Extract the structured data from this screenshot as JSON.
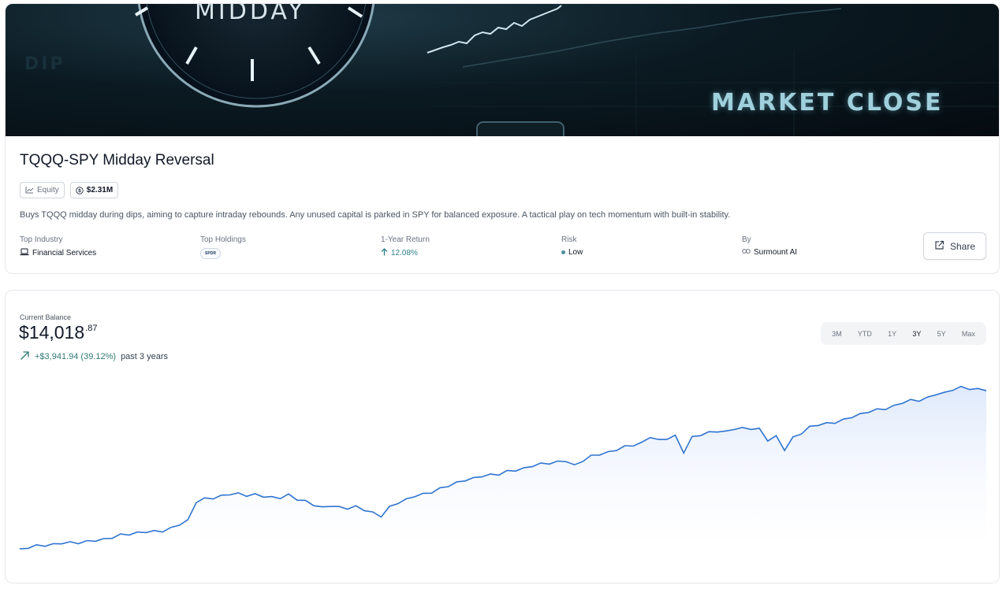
{
  "banner": {
    "midday_text": "MIDDAY",
    "market_close_text": "MARKET CLOSE",
    "dip_text": "DIP"
  },
  "strategy": {
    "title": "TQQQ-SPY Midday Reversal",
    "tags": {
      "asset_class": "Equity",
      "aum": "$2.31M"
    },
    "description": "Buys TQQQ midday during dips, aiming to capture intraday rebounds. Any unused capital is parked in SPY for balanced exposure. A tactical play on tech momentum with built-in stability.",
    "stats": {
      "top_industry": {
        "label": "Top Industry",
        "value": "Financial Services",
        "icon": "laptop-icon"
      },
      "top_holdings": {
        "label": "Top Holdings",
        "logo": "SPDR"
      },
      "one_year_return": {
        "label": "1-Year Return",
        "value": "12.08%",
        "icon": "arrow-up-icon"
      },
      "risk": {
        "label": "Risk",
        "value": "Low",
        "color": "#4b8f9c"
      },
      "by": {
        "label": "By",
        "value": "Surmount AI",
        "icon": "link-icon"
      }
    },
    "share_label": "Share"
  },
  "balance": {
    "label": "Current Balance",
    "value_main": "$14,018",
    "value_cents": ".87",
    "change_amount": "+$3,941.94 (39.12%)",
    "change_period": "past 3 years",
    "ranges": [
      "3M",
      "YTD",
      "1Y",
      "3Y",
      "5Y",
      "Max"
    ],
    "active_range": "3Y"
  },
  "chart_data": {
    "type": "area",
    "series": [
      {
        "values": [
          10077,
          10110,
          10130,
          10150,
          10170,
          10200,
          10230,
          10250,
          10270,
          10300,
          10330,
          10360,
          10400,
          10430,
          10460,
          10480,
          10510,
          10540,
          10600,
          10700,
          10800,
          11250,
          11300,
          11330,
          11380,
          11420,
          11450,
          11430,
          11440,
          11400,
          11380,
          11350,
          11400,
          11300,
          11250,
          11150,
          11100,
          11180,
          11120,
          11100,
          11150,
          11050,
          10950,
          10880,
          11100,
          11200,
          11300,
          11420,
          11450,
          11500,
          11600,
          11650,
          11700,
          11780,
          11820,
          11870,
          11920,
          11960,
          12020,
          12050,
          12100,
          12150,
          12170,
          12200,
          12230,
          12250,
          12150,
          12300,
          12400,
          12450,
          12500,
          12550,
          12600,
          12650,
          12700,
          12850,
          12780,
          12850,
          12900,
          12500,
          12880,
          12920,
          12950,
          13000,
          12980,
          13050,
          13080,
          13100,
          13070,
          12800,
          12900,
          12550,
          12820,
          12950,
          13100,
          13150,
          13200,
          13250,
          13300,
          13380,
          13450,
          13500,
          13520,
          13560,
          13620,
          13700,
          13780,
          13800,
          13850,
          13950,
          13980,
          14050,
          14080,
          14060,
          14040,
          14018
        ],
        "color": "#2f74d0"
      }
    ],
    "grid": false,
    "legend": "none"
  },
  "colors": {
    "line": "#2f74d0",
    "positive": "#2f7a74",
    "return": "#2f7f8c"
  }
}
